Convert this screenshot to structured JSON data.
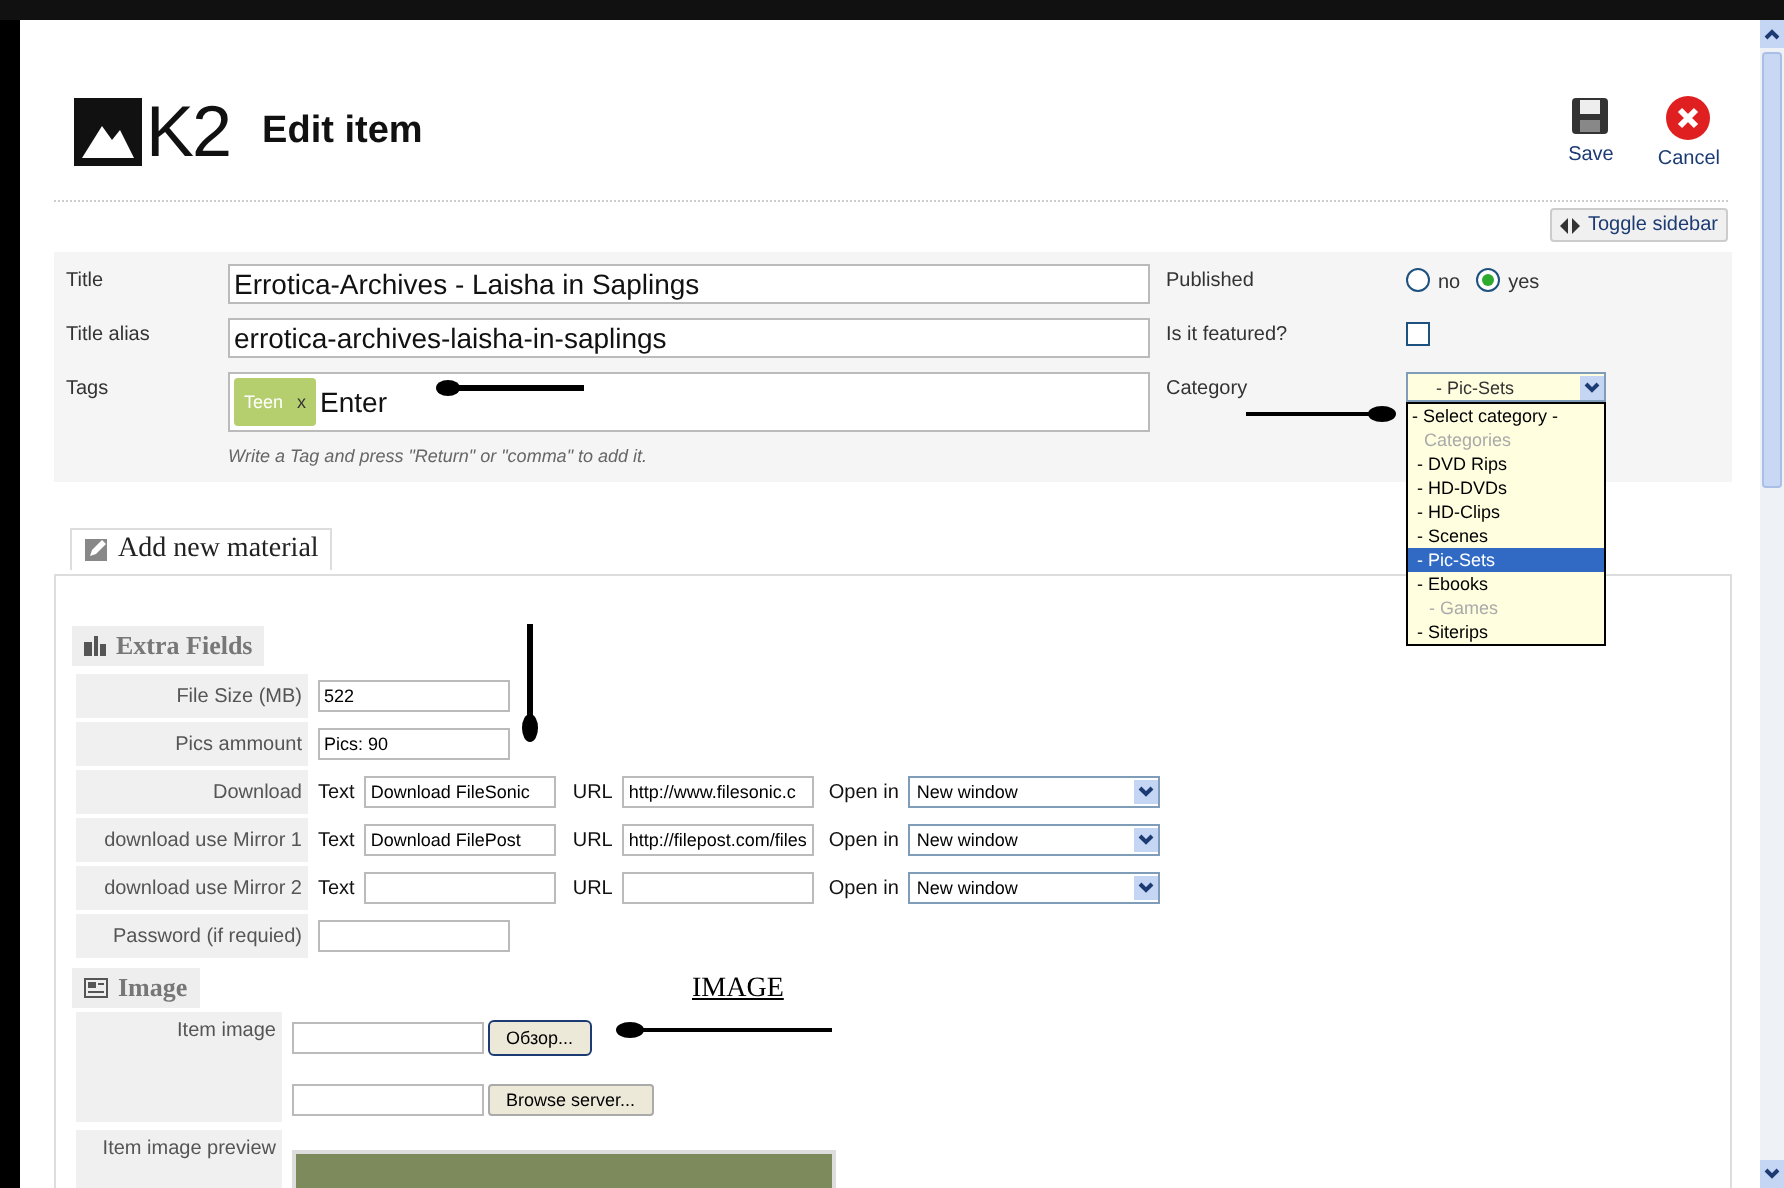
{
  "header": {
    "logo_text": "K2",
    "title": "Edit item",
    "actions": [
      {
        "kind": "save",
        "label": "Save"
      },
      {
        "kind": "cancel",
        "label": "Cancel"
      }
    ],
    "toggle": "Toggle sidebar"
  },
  "fields": {
    "title": {
      "label": "Title",
      "value": "Errotica-Archives - Laisha in Saplings"
    },
    "alias": {
      "label": "Title alias",
      "value": "errotica-archives-laisha-in-saplings"
    },
    "tags": {
      "label": "Tags",
      "chips": [
        {
          "label": "Teen",
          "remove": "x"
        }
      ],
      "value": "Enter",
      "hint": "Write a Tag and press \"Return\" or \"comma\" to add it."
    },
    "published": {
      "label": "Published",
      "options": [
        {
          "label": "no",
          "selected": false
        },
        {
          "label": "yes",
          "selected": true
        }
      ]
    },
    "featured": {
      "label": "Is it featured?",
      "checked": false
    },
    "category": {
      "label": "Category",
      "value": "- Pic-Sets",
      "expanded": true,
      "options": [
        {
          "label": "- Select category -",
          "selected": false,
          "disabled": false
        },
        {
          "label": "Categories",
          "selected": false,
          "disabled": true
        },
        {
          "label": " - DVD Rips",
          "selected": false,
          "disabled": false
        },
        {
          "label": " - HD-DVDs",
          "selected": false,
          "disabled": false
        },
        {
          "label": " - HD-Clips",
          "selected": false,
          "disabled": false
        },
        {
          "label": " - Scenes",
          "selected": false,
          "disabled": false
        },
        {
          "label": " - Pic-Sets",
          "selected": true,
          "disabled": false
        },
        {
          "label": " - Ebooks",
          "selected": false,
          "disabled": false
        },
        {
          "label": " - Games",
          "selected": false,
          "disabled": true
        },
        {
          "label": " - Siterips",
          "selected": false,
          "disabled": false
        }
      ]
    }
  },
  "tabs": [
    {
      "label": "Add new material",
      "selected": true
    }
  ],
  "extra_fields": {
    "heading": "Extra Fields",
    "rows": [
      {
        "kind": "text",
        "label": "File Size (MB)",
        "value": "522"
      },
      {
        "kind": "text",
        "label": "Pics ammount",
        "value": "Pics: 90"
      },
      {
        "kind": "link",
        "label": "Download",
        "text_label": "Text",
        "text": "Download FileSonic",
        "url_label": "URL",
        "url": "http://www.filesonic.c",
        "target_label": "Open in",
        "target": "New window"
      },
      {
        "kind": "link",
        "label": "download use Mirror 1",
        "text_label": "Text",
        "text": "Download FilePost",
        "url_label": "URL",
        "url": "http://filepost.com/files",
        "target_label": "Open in",
        "target": "New window"
      },
      {
        "kind": "link",
        "label": "download use Mirror 2",
        "text_label": "Text",
        "url_label": "URL",
        "target_label": "Open in",
        "target": "New window"
      },
      {
        "kind": "text",
        "label": "Password (if requied)"
      }
    ]
  },
  "image": {
    "heading": "Image",
    "item_image_label": "Item image",
    "browse_button": "Обзор...",
    "server_button": "Browse server...",
    "preview_label": "Item image preview"
  },
  "annotation": {
    "label": "IMAGE"
  }
}
